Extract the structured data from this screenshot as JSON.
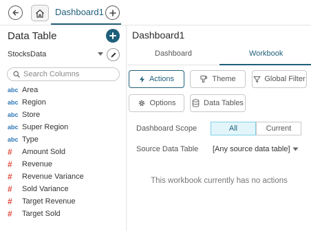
{
  "topbar": {
    "back_icon": "arrow-left-icon",
    "home_icon": "home-icon",
    "tab_label": "Dashboard1",
    "add_icon": "plus-icon"
  },
  "left_panel": {
    "title": "Data Table",
    "source": "StocksData",
    "search_placeholder": "Search Columns",
    "columns": [
      {
        "type": "abc",
        "label": "Area"
      },
      {
        "type": "abc",
        "label": "Region"
      },
      {
        "type": "abc",
        "label": "Store"
      },
      {
        "type": "abc",
        "label": "Super Region"
      },
      {
        "type": "abc",
        "label": "Type"
      },
      {
        "type": "#",
        "label": "Amount Sold"
      },
      {
        "type": "#",
        "label": "Revenue"
      },
      {
        "type": "#",
        "label": "Revenue Variance"
      },
      {
        "type": "#",
        "label": "Sold Variance"
      },
      {
        "type": "#",
        "label": "Target Revenue"
      },
      {
        "type": "#",
        "label": "Target Sold"
      }
    ]
  },
  "right_panel": {
    "title": "Dashboard1",
    "tabs": [
      {
        "label": "Dashboard",
        "active": false
      },
      {
        "label": "Workbook",
        "active": true
      }
    ],
    "buttons": {
      "actions": "Actions",
      "theme": "Theme",
      "global_filter": "Global Filter",
      "options": "Options",
      "data_tables": "Data Tables"
    },
    "scope_label": "Dashboard Scope",
    "scope_options": [
      "All",
      "Current"
    ],
    "scope_selected": "All",
    "source_label": "Source Data Table",
    "source_value": "[Any source data table]",
    "empty_message": "This workbook currently has no actions"
  },
  "colors": {
    "accent": "#1f5f7a",
    "string_type": "#2f78b8",
    "numeric_type": "#e0493a",
    "selected_bg": "#e2f5fb"
  }
}
